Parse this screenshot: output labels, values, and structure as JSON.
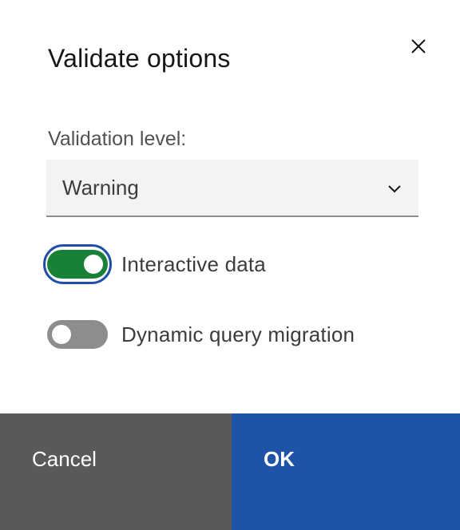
{
  "dialog": {
    "title": "Validate options",
    "close_icon": "close-icon"
  },
  "validation_level": {
    "label": "Validation level:",
    "selected": "Warning",
    "icon": "chevron-down-icon"
  },
  "toggles": [
    {
      "label": "Interactive data",
      "checked": true,
      "color": "#198038"
    },
    {
      "label": "Dynamic query migration",
      "checked": false,
      "color": "#8d8d8d"
    }
  ],
  "footer": {
    "cancel_label": "Cancel",
    "ok_label": "OK",
    "cancel_color": "#595959",
    "ok_color": "#1f53a8"
  }
}
